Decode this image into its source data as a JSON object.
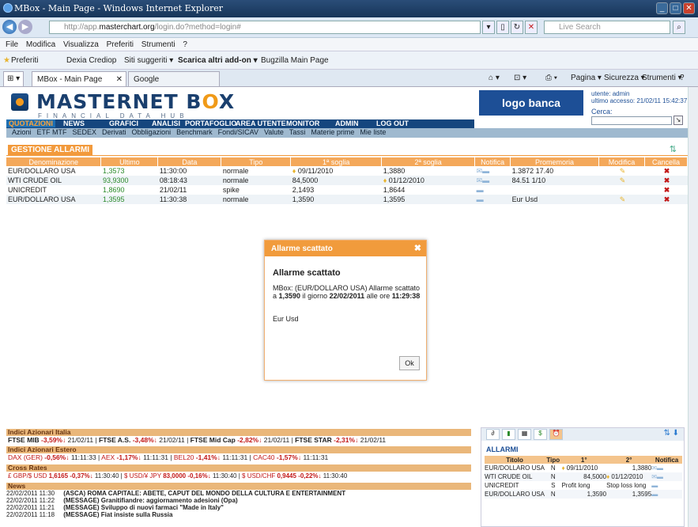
{
  "window": {
    "title": "MBox - Main Page - Windows Internet Explorer"
  },
  "browser": {
    "url_prefix": "http://app.",
    "url_domain": "masterchart.org",
    "url_suffix": "/login.do?method=login#",
    "search_placeholder": "Live Search",
    "menu": [
      "File",
      "Modifica",
      "Visualizza",
      "Preferiti",
      "Strumenti",
      "?"
    ],
    "favorites": [
      "Preferiti",
      "Dexia Crediop",
      "Siti suggeriti ▾",
      "Scarica altri add-on ▾",
      "Bugzilla Main Page"
    ],
    "tabs": [
      "MBox - Main Page",
      "Google"
    ],
    "toolbar": [
      "Pagina ▾",
      "Sicurezza ▾",
      "Strumenti ▾"
    ]
  },
  "brand": {
    "name_a": "MASTERNET B",
    "name_x": "O",
    "name_b": "X",
    "sub": "FINANCIAL DATA HUB",
    "banca": "logo banca"
  },
  "user": {
    "utente": "utente: admin",
    "accesso": "ultimo accesso: 21/02/11 15:42:37",
    "cerca": "Cerca:"
  },
  "nav": [
    "QUOTAZIONI",
    "NEWS",
    "GRAFICI",
    "ANALISI",
    "PORTAFOGLIO",
    "AREA UTENTE",
    "MONITOR",
    "ADMIN",
    "LOG OUT"
  ],
  "subnav": [
    "Azioni",
    "ETF MTF",
    "SEDEX",
    "Derivati",
    "Obbligazioni",
    "Benchmark",
    "Fondi/SICAV",
    "Valute",
    "Tassi",
    "Materie prime",
    "Mie liste"
  ],
  "gestione": {
    "title": "GESTIONE ALLARMI",
    "headers": [
      "Denominazione",
      "Ultimo",
      "Data",
      "Tipo",
      "1ª soglia",
      "2ª soglia",
      "Notifica",
      "Promemoria",
      "Modifica",
      "Cancella"
    ],
    "rows": [
      [
        "EUR/DOLLARO USA",
        "1,3573",
        "11:30:00",
        "normale",
        "09/11/2010",
        "1,3880",
        "",
        "1.3872 17.40"
      ],
      [
        "WTI CRUDE OIL",
        "93,9300",
        "08:18:43",
        "normale",
        "84,5000",
        "01/12/2010",
        "",
        "84.51 1/10"
      ],
      [
        "UNICREDIT",
        "1,8690",
        "21/02/11",
        "spike",
        "2,1493",
        "1,8644",
        "",
        ""
      ],
      [
        "EUR/DOLLARO USA",
        "1,3595",
        "11:30:38",
        "normale",
        "1,3590",
        "1,3595",
        "",
        "Eur Usd"
      ]
    ]
  },
  "dialog": {
    "header": "Allarme scattato",
    "title": "Allarme scattato",
    "m1": "MBox: (EUR/DOLLARO USA) Allarme scattato a",
    "v1": "1,3590",
    "m2": "il giorno",
    "v2": "22/02/2011",
    "m3": "alle ore",
    "v3": "11:29:38",
    "extra": "Eur Usd",
    "ok": "Ok"
  },
  "ticker": {
    "h1": "Indici Azionari Italia",
    "r1": [
      "FTSE MIB",
      "-3,59%",
      "21/02/11",
      "FTSE A.S.",
      "-3,48%",
      "21/02/11",
      "FTSE Mid Cap",
      "-2,82%",
      "21/02/11",
      "FTSE STAR",
      "-2,31%",
      "21/02/11"
    ],
    "h2": "Indici Azionari Estero",
    "r2": [
      "DAX (GER)",
      "-0,56%",
      "11:11:33",
      "AEX",
      "-1,17%",
      "11:11:31",
      "BEL20",
      "-1,41%",
      "11:11:31",
      "CAC40",
      "-1,57%",
      "11:11:31"
    ],
    "h3": "Cross Rates",
    "r3": [
      "£ GBP/$ USD",
      "1,6165",
      "-0,37%",
      "11:30:40",
      "$ USD/¥ JPY",
      "83,0000",
      "-0,16%",
      "11:30:40",
      "$ USD/CHF",
      "0,9445",
      "-0,22%",
      "11:30:40"
    ],
    "h4": "News",
    "news": [
      [
        "22/02/2011 11:30",
        "(ASCA) ROMA CAPITALE: ABETE, CAPUT DEL MONDO DELLA CULTURA E ENTERTAINMENT"
      ],
      [
        "22/02/2011 11:22",
        "(MESSAGE) Granitifiandre: aggiornamento adesioni (Opa)"
      ],
      [
        "22/02/2011 11:21",
        "(MESSAGE) Sviluppo di nuovi farmaci \"Made in Italy\""
      ],
      [
        "22/02/2011 11:18",
        "(MESSAGE) Fiat insiste sulla Russia"
      ]
    ]
  },
  "allarmi": {
    "title": "ALLARMI",
    "headers": [
      "Titolo",
      "Tipo",
      "1°",
      "2°",
      "Notifica"
    ],
    "rows": [
      [
        "EUR/DOLLARO USA",
        "N",
        "09/11/2010",
        "1,3880"
      ],
      [
        "WTI CRUDE OIL",
        "N",
        "84,5000",
        "01/12/2010"
      ],
      [
        "UNICREDIT",
        "S",
        "Profit long",
        "Stop loss long"
      ],
      [
        "EUR/DOLLARO USA",
        "N",
        "1,3590",
        "1,3595"
      ]
    ]
  }
}
